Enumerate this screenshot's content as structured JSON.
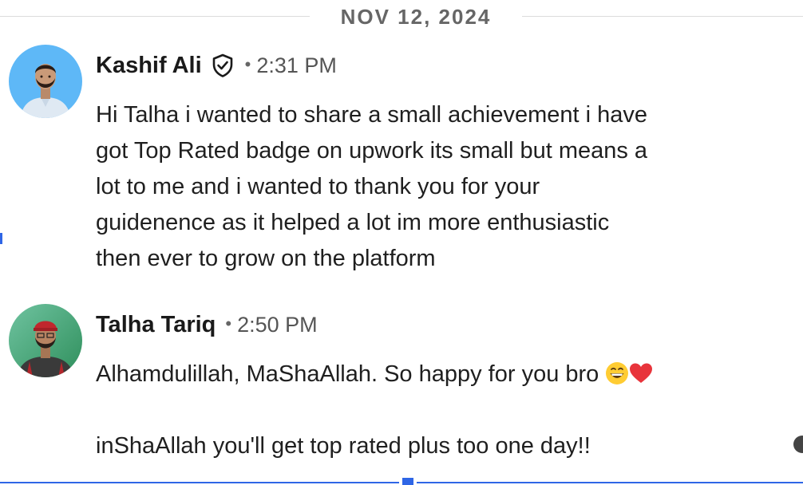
{
  "date_divider": {
    "label": "NOV 12, 2024"
  },
  "messages": [
    {
      "sender": "Kashif Ali",
      "verified": true,
      "separator": "•",
      "time": "2:31 PM",
      "avatar_bg": "#5eb8f7",
      "lines": [
        "Hi Talha i wanted to share a small achievement i have",
        "got  Top Rated badge on upwork its small but means a",
        "lot to me and i wanted to thank you for your",
        "guidenence as it helped a lot im more enthusiastic",
        "then ever to grow on the platform"
      ]
    },
    {
      "sender": "Talha Tariq",
      "verified": false,
      "separator": "•",
      "time": "2:50 PM",
      "avatar_bg": "#3f9e6b",
      "paragraph_1": "Alhamdulillah, MaShaAllah. So happy for you bro",
      "paragraph_1_emojis": [
        "grinning-face-emoji",
        "red-heart-emoji"
      ],
      "paragraph_2": "inShaAllah you'll get top rated plus too one day!!"
    }
  ],
  "colors": {
    "accent_selection": "#2f66e6",
    "divider_line": "#dcdcdc",
    "meta_text": "#555555"
  }
}
